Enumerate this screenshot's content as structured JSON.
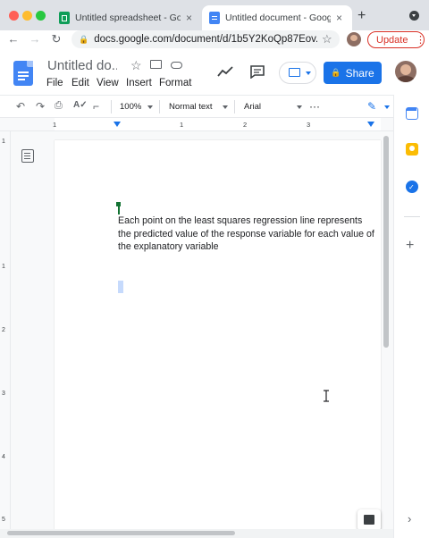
{
  "browser": {
    "tabs": [
      {
        "title": "Untitled spreadsheet - Goog",
        "icon": "sheets-icon",
        "close": "×",
        "active": false
      },
      {
        "title": "Untitled document - Googl",
        "icon": "docs-icon",
        "close": "×",
        "active": true
      }
    ],
    "new_tab": "+",
    "url": "docs.google.com/document/d/1b5Y2KoQp87Eov...",
    "update_label": "Update",
    "menu_dots": "⋮"
  },
  "docs": {
    "title": "Untitled do...",
    "menu": [
      "File",
      "Edit",
      "View",
      "Insert",
      "Format"
    ],
    "share_label": "Share",
    "lock_glyph": "🔒"
  },
  "toolbar": {
    "zoom": "100%",
    "style": "Normal text",
    "font": "Arial",
    "more": "···"
  },
  "ruler": {
    "numbers": [
      "1",
      "1",
      "2",
      "3"
    ]
  },
  "vruler": {
    "numbers": [
      "1",
      "1",
      "2",
      "3",
      "4",
      "5"
    ]
  },
  "document": {
    "paragraph": "Each point on the least squares regression line represents the predicted value of the response variable for each value of the explanatory variable"
  },
  "colors": {
    "accent": "#1a73e8",
    "update_red": "#d93025",
    "sheets_green": "#0f9d58",
    "docs_blue": "#4285f4",
    "cursor_green": "#137333"
  }
}
